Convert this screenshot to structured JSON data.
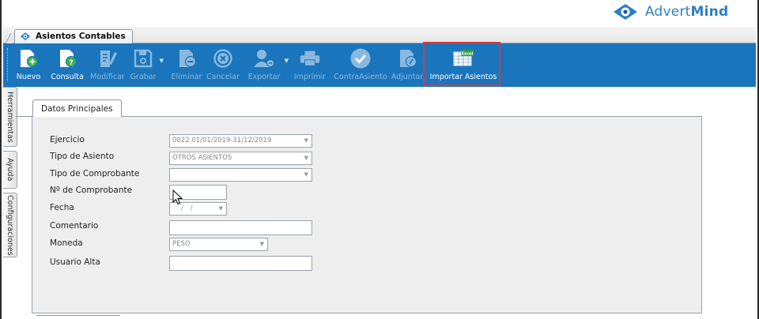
{
  "brand": {
    "name_light": "Advert",
    "name_bold": "Mind"
  },
  "document_tab": {
    "label": "Asientos Contables"
  },
  "toolbar": {
    "buttons": [
      {
        "label": "Nuevo",
        "icon": "new-doc-icon",
        "enabled": true
      },
      {
        "label": "Consulta",
        "icon": "query-doc-icon",
        "enabled": true
      },
      {
        "label": "Modificar",
        "icon": "edit-doc-icon",
        "enabled": false
      },
      {
        "label": "Grabar",
        "icon": "save-icon",
        "enabled": false
      },
      {
        "label": "Eliminar",
        "icon": "delete-doc-icon",
        "enabled": false
      },
      {
        "label": "Cancelar",
        "icon": "cancel-icon",
        "enabled": false
      },
      {
        "label": "Exportar",
        "icon": "export-user-icon",
        "enabled": false
      },
      {
        "label": "Imprimir",
        "icon": "printer-icon",
        "enabled": false
      },
      {
        "label": "ContraAsiento",
        "icon": "check-icon",
        "enabled": false
      },
      {
        "label": "Adjuntar",
        "icon": "attach-icon",
        "enabled": false
      },
      {
        "label": "Importar Asientos",
        "icon": "excel-import-icon",
        "enabled": true
      }
    ]
  },
  "side_tabs": [
    "Herramientas",
    "Ayuda",
    "Configuraciones"
  ],
  "section": {
    "title": "Datos Principales"
  },
  "form": {
    "ejercicio": {
      "label": "Ejercicio",
      "value": "0022 01/01/2019-31/12/2019"
    },
    "tipo_asiento": {
      "label": "Tipo de Asiento",
      "value": "OTROS ASIENTOS"
    },
    "tipo_comprobante": {
      "label": "Tipo de Comprobante",
      "value": ""
    },
    "nro_comprobante": {
      "label": "Nº de Comprobante",
      "value": ""
    },
    "fecha": {
      "label": "Fecha",
      "value": "/ /"
    },
    "comentario": {
      "label": "Comentario",
      "value": ""
    },
    "moneda": {
      "label": "Moneda",
      "value": "PESO"
    },
    "usuario_alta": {
      "label": "Usuario Alta",
      "value": ""
    }
  },
  "colors": {
    "toolbar_bg": "#1b75bc",
    "highlight": "#e0353d",
    "brand": "#2f7fc4"
  }
}
